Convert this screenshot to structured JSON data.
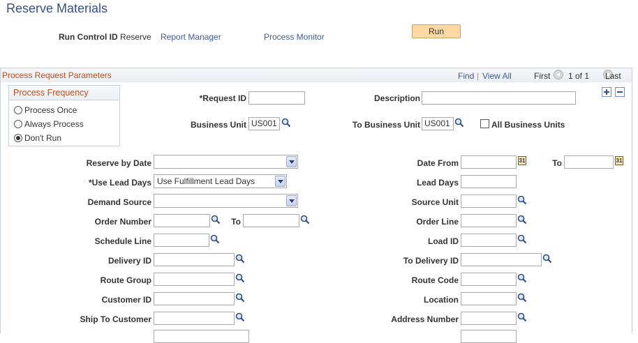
{
  "page": {
    "title": "Reserve Materials"
  },
  "header": {
    "run_control_label": "Run Control ID",
    "run_control_value": "Reserve",
    "report_manager": "Report Manager",
    "process_monitor": "Process Monitor",
    "run_button": "Run"
  },
  "section": {
    "title": "Process Request Parameters",
    "find": "Find",
    "separator": "|",
    "view_all": "View All",
    "first": "First",
    "page_info": "1 of 1",
    "last": "Last"
  },
  "frequency": {
    "title": "Process Frequency",
    "options": [
      {
        "label": "Process Once",
        "selected": false
      },
      {
        "label": "Always Process",
        "selected": false
      },
      {
        "label": "Don't Run",
        "selected": true
      }
    ]
  },
  "form": {
    "request_id": {
      "label": "*Request ID",
      "value": ""
    },
    "description": {
      "label": "Description",
      "value": ""
    },
    "business_unit": {
      "label": "Business Unit",
      "value": "US001"
    },
    "to_business_unit": {
      "label": "To Business Unit",
      "value": "US001"
    },
    "all_business_units": {
      "label": "All Business Units",
      "checked": false
    },
    "reserve_by_date": {
      "label": "Reserve by Date",
      "value": ""
    },
    "date_from": {
      "label": "Date From",
      "value": ""
    },
    "date_to": {
      "label": "To",
      "value": ""
    },
    "use_lead_days": {
      "label": "*Use Lead Days",
      "value": "Use Fulfillment Lead Days"
    },
    "lead_days": {
      "label": "Lead Days",
      "value": ""
    },
    "demand_source": {
      "label": "Demand Source",
      "value": ""
    },
    "source_unit": {
      "label": "Source Unit",
      "value": ""
    },
    "order_number": {
      "label": "Order Number",
      "value": ""
    },
    "order_number_to": {
      "label": "To",
      "value": ""
    },
    "order_line": {
      "label": "Order Line",
      "value": ""
    },
    "schedule_line": {
      "label": "Schedule Line",
      "value": ""
    },
    "load_id": {
      "label": "Load ID",
      "value": ""
    },
    "delivery_id": {
      "label": "Delivery ID",
      "value": ""
    },
    "to_delivery_id": {
      "label": "To Delivery ID",
      "value": ""
    },
    "route_group": {
      "label": "Route Group",
      "value": ""
    },
    "route_code": {
      "label": "Route Code",
      "value": ""
    },
    "customer_id": {
      "label": "Customer ID",
      "value": ""
    },
    "location": {
      "label": "Location",
      "value": ""
    },
    "ship_to_customer": {
      "label": "Ship To Customer",
      "value": ""
    },
    "address_number": {
      "label": "Address Number",
      "value": ""
    }
  },
  "icons": {
    "lookup": "magnifier-icon",
    "calendar": "calendar-icon",
    "calendar_glyph": "31",
    "add": "plus-icon",
    "remove": "minus-icon",
    "first": "previous-circle-icon",
    "last": "next-circle-icon"
  },
  "colors": {
    "title": "#35508a",
    "link": "#3c5c9a",
    "section_title": "#b75122",
    "run_button": "#fcd9a2"
  }
}
